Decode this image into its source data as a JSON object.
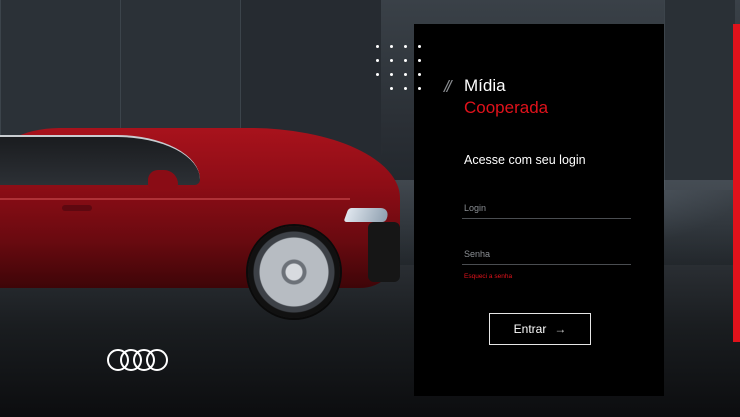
{
  "brand": {
    "logo": "audi-four-rings-logo",
    "accent_color": "#e0121b"
  },
  "login": {
    "title_line1": "Mídia",
    "title_line2": "Cooperada",
    "decoration": "//",
    "subtitle": "Acesse com seu login",
    "login_placeholder": "Login",
    "password_placeholder": "Senha",
    "forgot_password": "Esqueci a senha",
    "submit_label": "Entrar",
    "submit_icon": "arrow-right-icon"
  }
}
